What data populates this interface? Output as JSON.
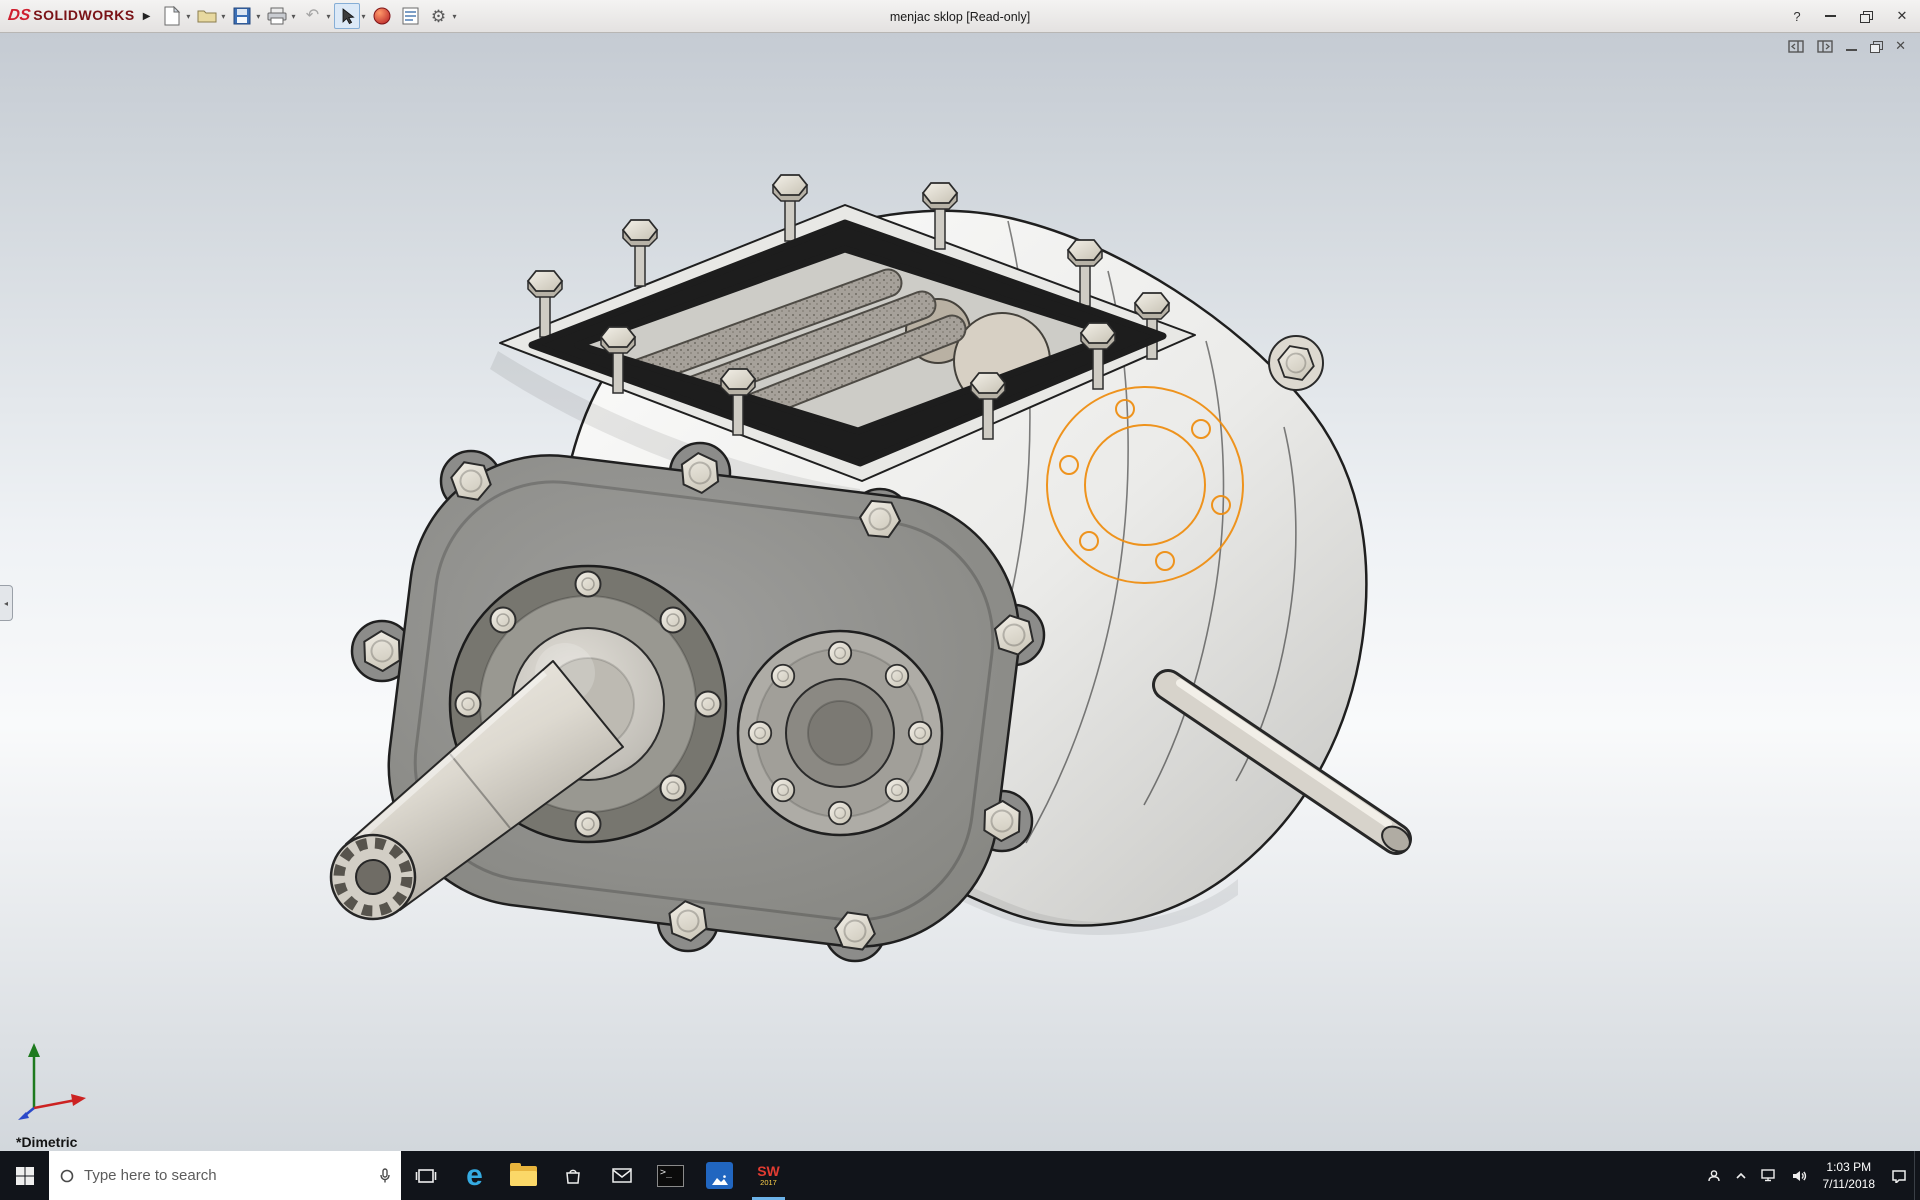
{
  "app": {
    "logo_prefix": "DS",
    "logo_text": "SOLIDWORKS",
    "title": "menjac sklop [Read-only]"
  },
  "toolbar": {
    "icon_names": [
      "new-document",
      "open-document",
      "save",
      "print",
      "undo",
      "select-cursor",
      "appearances-sphere",
      "display-settings",
      "options-gear"
    ]
  },
  "viewport": {
    "orientation_label": "*Dimetric"
  },
  "taskbar": {
    "search_placeholder": "Type here to search",
    "app_icons": [
      "start",
      "task-view",
      "edge",
      "file-explorer",
      "store",
      "mail",
      "command-prompt",
      "photos",
      "solidworks-2017"
    ],
    "solidworks_badge": {
      "label": "SW",
      "year": "2017"
    },
    "clock": {
      "time": "1:03 PM",
      "date": "7/11/2018"
    }
  },
  "glyphs": {
    "flyout_arrow": "▶",
    "caret_down": "▾",
    "question": "?",
    "close": "✕",
    "gear": "⚙",
    "undo_arrow": "↶",
    "edge_e": "e",
    "prompt": ">_",
    "collapse_arrow": "◂"
  },
  "colors": {
    "solidworks_red": "#cf2030",
    "sketch_orange": "#ef8f13",
    "taskbar_bg": "#11141a",
    "viewport_gradient_top": "#c5cbd3",
    "viewport_gradient_bottom": "#d2d7dc"
  }
}
